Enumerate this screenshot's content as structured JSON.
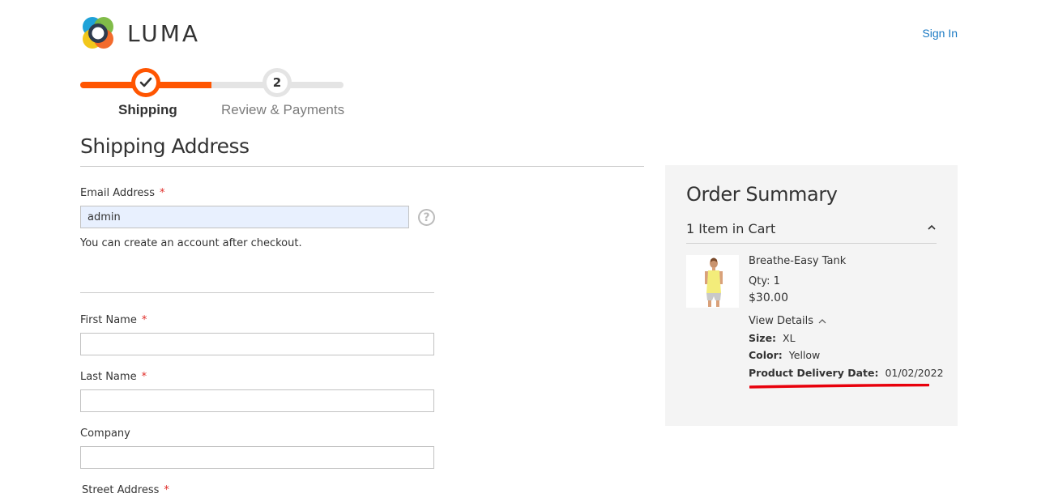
{
  "header": {
    "logo_text": "LUMA",
    "sign_in_label": "Sign In"
  },
  "progress": {
    "steps": [
      {
        "number": "1",
        "label": "Shipping",
        "state": "completed"
      },
      {
        "number": "2",
        "label": "Review & Payments",
        "state": "pending"
      }
    ],
    "accent_color": "#ff5501"
  },
  "shipping": {
    "title": "Shipping Address",
    "email": {
      "label": "Email Address",
      "required": "*",
      "value": "admin"
    },
    "account_note": "You can create an account after checkout.",
    "first_name": {
      "label": "First Name",
      "required": "*",
      "value": ""
    },
    "last_name": {
      "label": "Last Name",
      "required": "*",
      "value": ""
    },
    "company": {
      "label": "Company",
      "value": ""
    },
    "street": {
      "label": "Street Address",
      "required": "*"
    }
  },
  "summary": {
    "title": "Order Summary",
    "cart_count": "1 Item in Cart",
    "item": {
      "name": "Breathe-Easy Tank",
      "qty": "Qty: 1",
      "price": "$30.00",
      "view_details": "View Details",
      "options": [
        {
          "key": "Size:",
          "value": "XL"
        },
        {
          "key": "Color:",
          "value": "Yellow"
        },
        {
          "key": "Product Delivery Date:",
          "value": "01/02/2022"
        }
      ]
    }
  },
  "colors": {
    "link": "#1979c3",
    "required": "#e02b27",
    "annotation": "#e8000b"
  }
}
